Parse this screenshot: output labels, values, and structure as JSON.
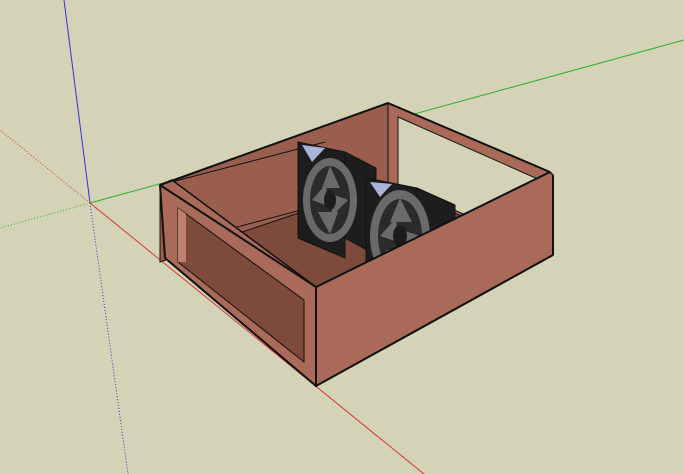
{
  "app": {
    "name": "",
    "window_title": ""
  },
  "viewport": {
    "background": "#d5d3b7",
    "axis_colors": {
      "red": "#d83434",
      "green": "#2fae2f",
      "blue": "#3434d8"
    }
  },
  "model": {
    "case_color_light": "#a96a5a",
    "case_color_dark": "#7a4637",
    "edge_color": "#111111",
    "fan_count": 2,
    "fan_housing_color": "#1d1d1d",
    "fan_blade_color": "#6a6a6a",
    "fan_label_color": "#a9b4d8"
  }
}
